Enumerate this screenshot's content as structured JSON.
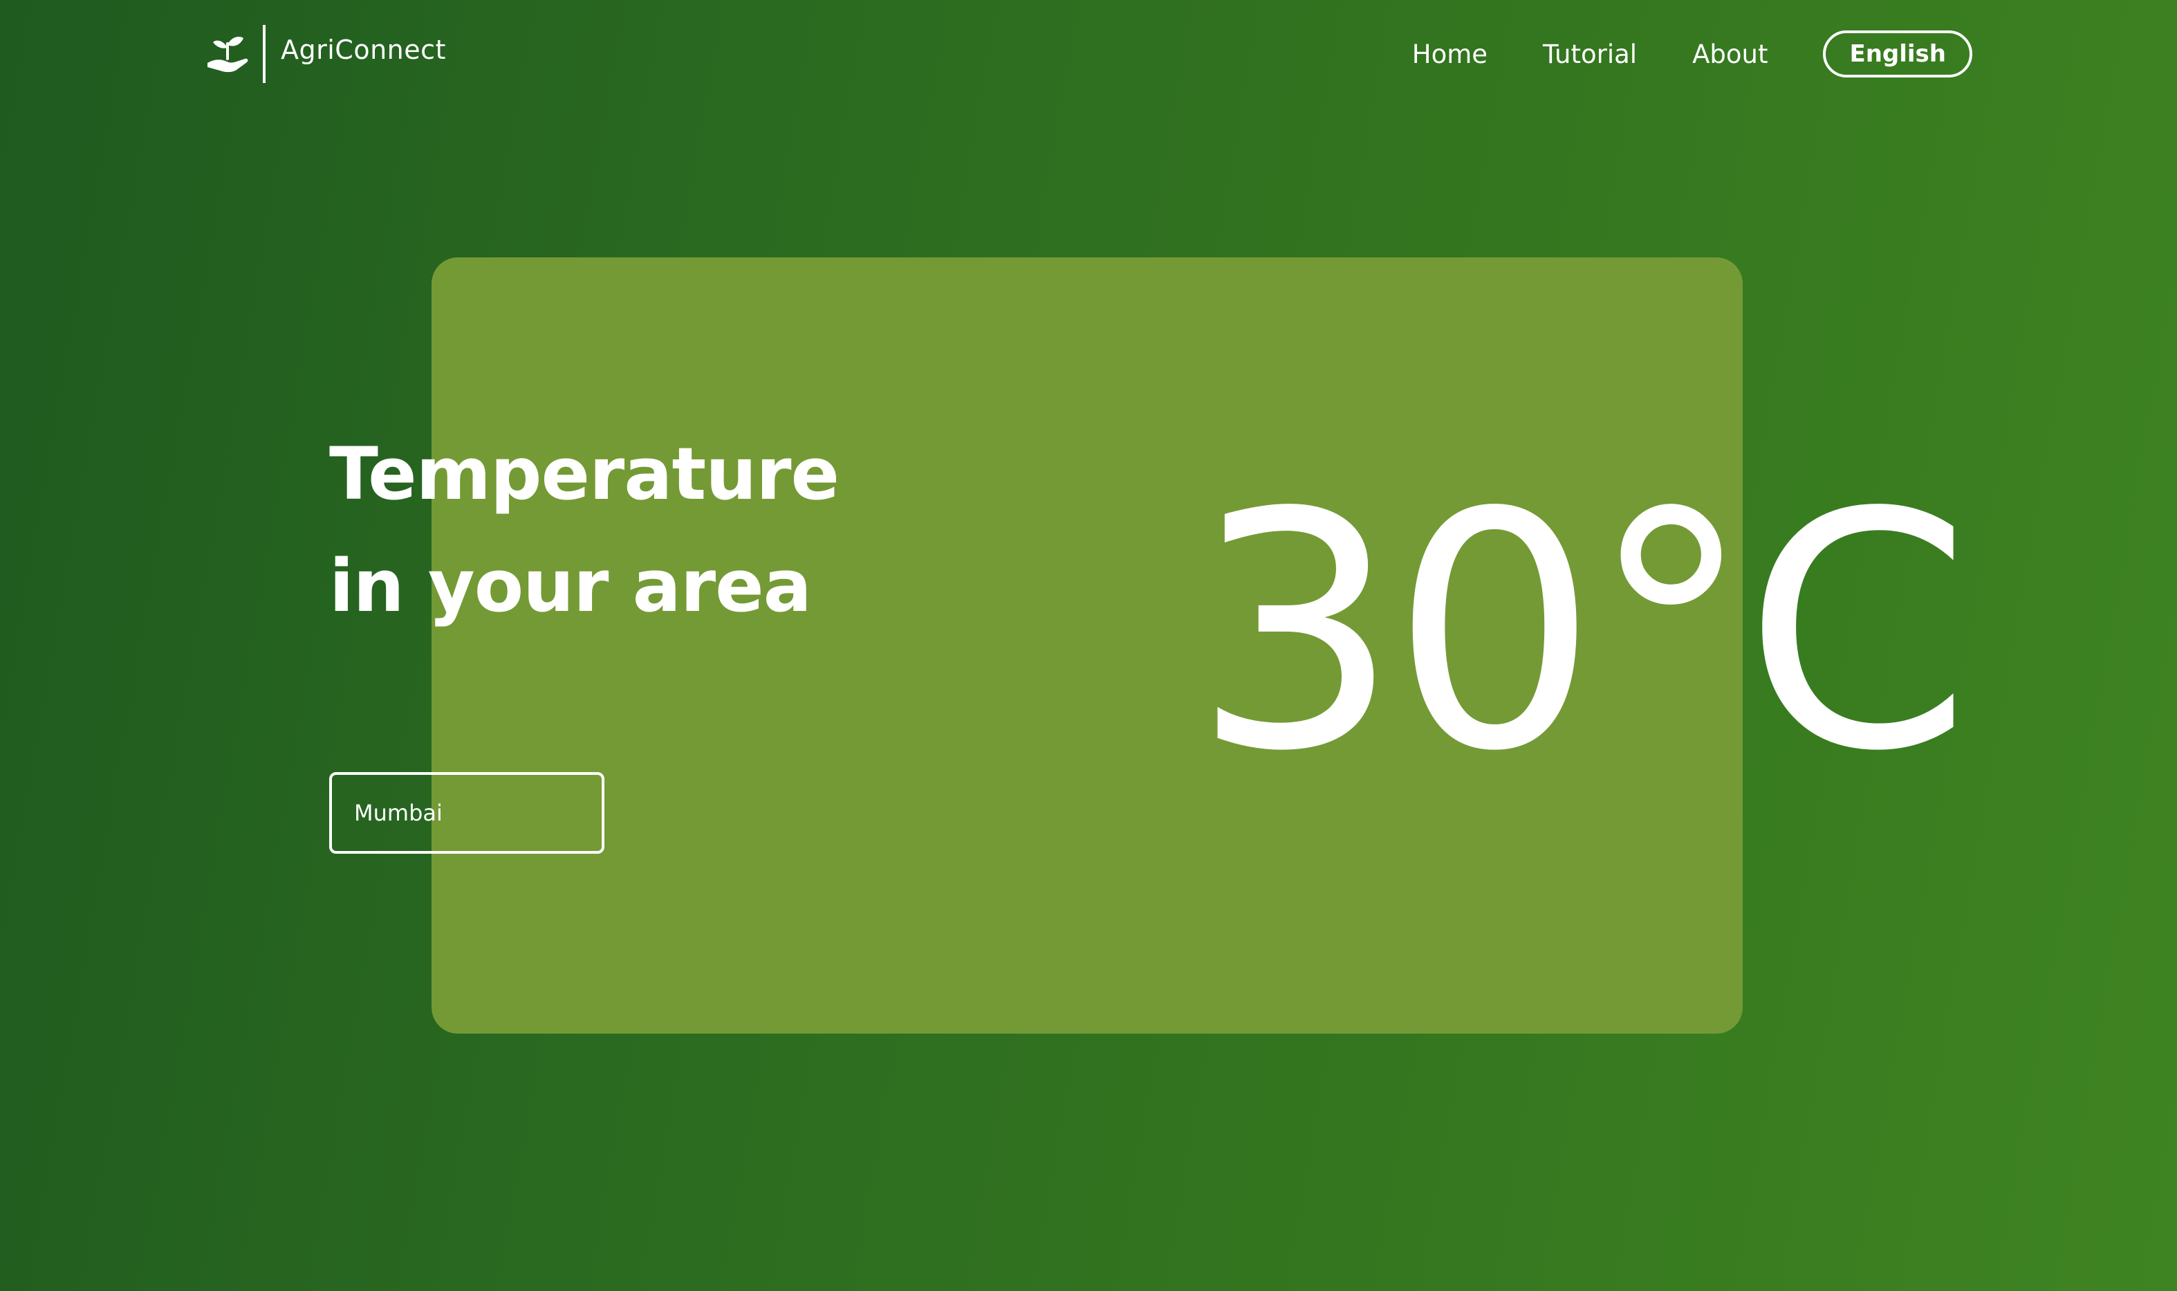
{
  "brand": {
    "name": "AgriConnect",
    "logo_icon": "hand-with-sprout-icon"
  },
  "nav": {
    "links": [
      "Home",
      "Tutorial",
      "About"
    ],
    "language": "English"
  },
  "main": {
    "heading_line1": "Temperature",
    "heading_line2": "in your area",
    "city_value": "Mumbai",
    "temperature": "30°C"
  },
  "colors": {
    "background_start": "#1f5a1f",
    "background_end": "#3f8422",
    "card": "#749a35",
    "text": "#ffffff"
  }
}
